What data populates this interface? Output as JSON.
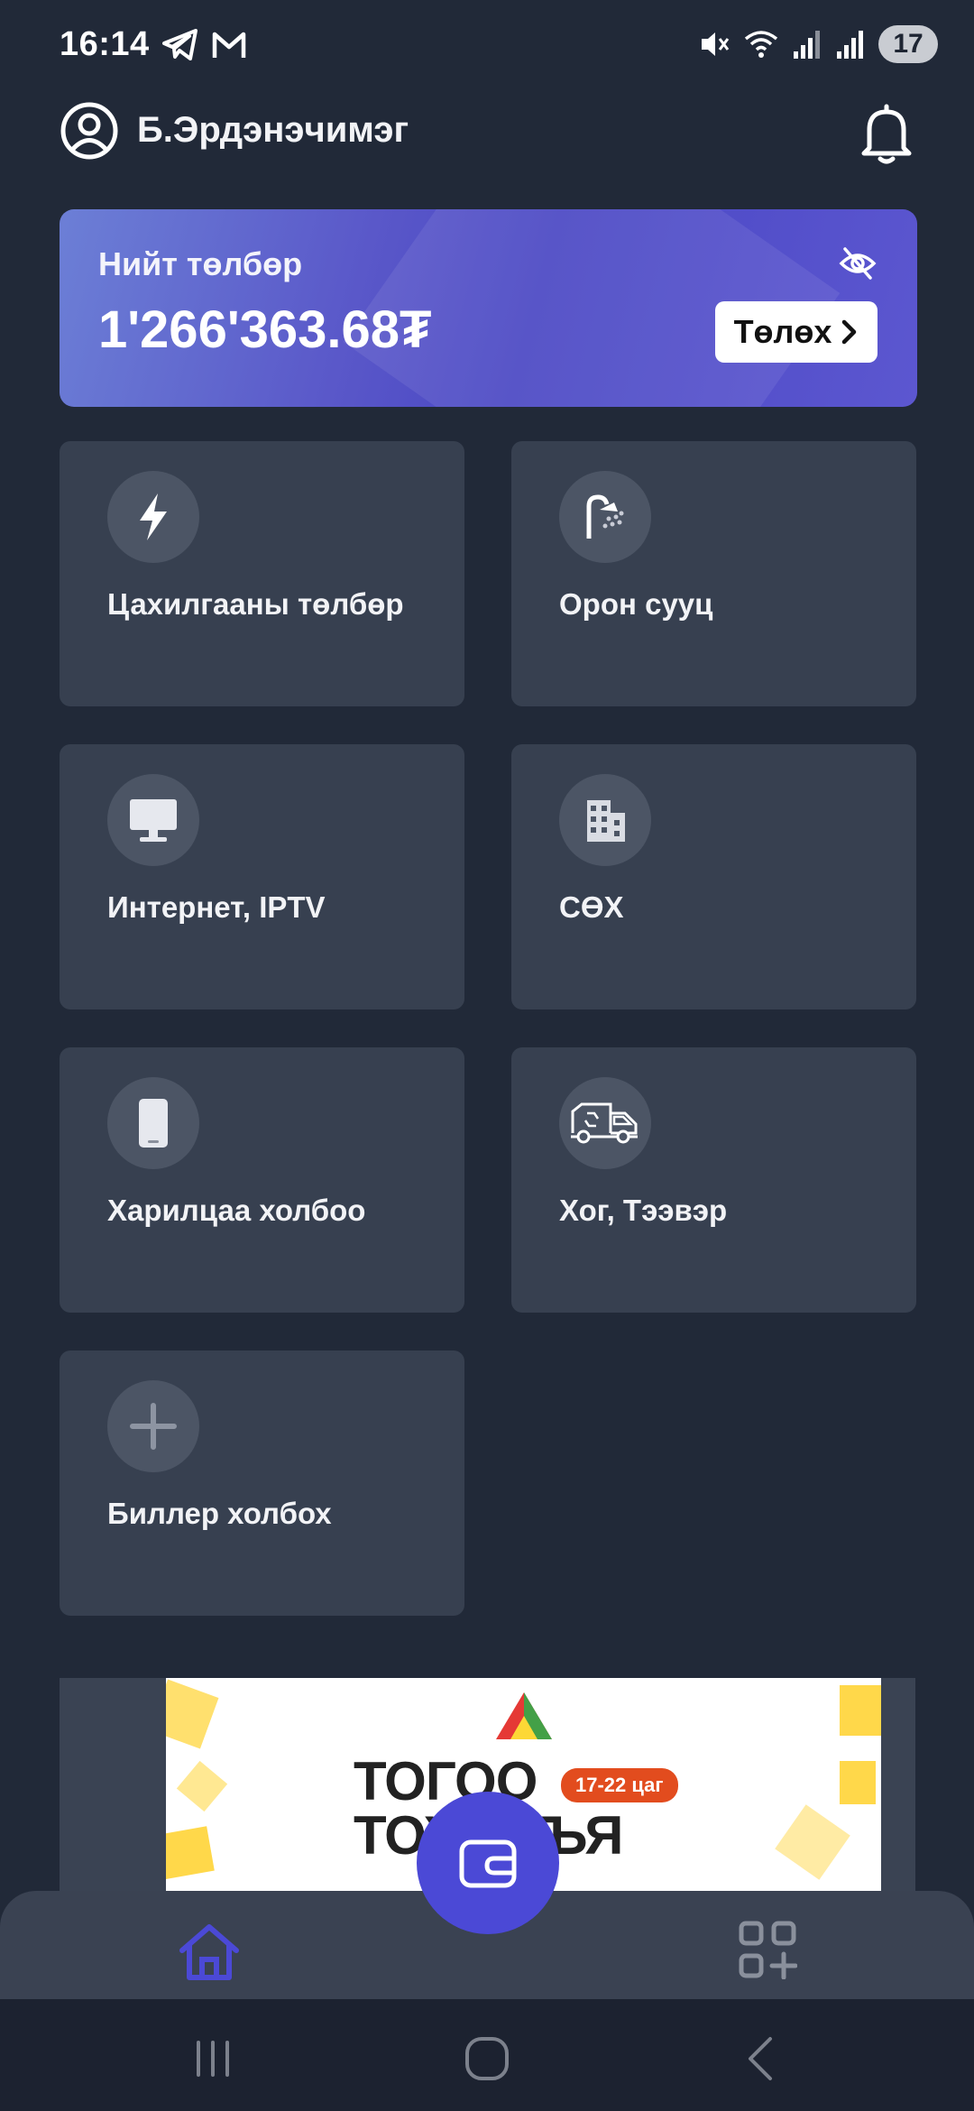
{
  "status_bar": {
    "time": "16:14",
    "battery": "17",
    "left_icons": [
      "telegram-icon",
      "gmail-icon"
    ],
    "right_icons": [
      "mute-icon",
      "wifi-icon",
      "signal-icon",
      "signal-icon"
    ]
  },
  "header": {
    "user_name": "Б.Эрдэнэчимэг"
  },
  "total_card": {
    "label": "Нийт төлбөр",
    "amount": "1'266'363.68₮",
    "pay_button": "Төлөх",
    "gradient_colors": [
      "#6c7fd6",
      "#4a47c4"
    ]
  },
  "tiles": [
    {
      "label": "Цахилгааны төлбөр",
      "icon": "lightning-icon"
    },
    {
      "label": "Орон сууц",
      "icon": "shower-icon"
    },
    {
      "label": "Интернет, IPTV",
      "icon": "monitor-icon"
    },
    {
      "label": "СӨХ",
      "icon": "building-icon"
    },
    {
      "label": "Харилцаа холбоо",
      "icon": "phone-icon"
    },
    {
      "label": "Хог, Тээвэр",
      "icon": "truck-icon"
    },
    {
      "label": "Биллер холбох",
      "icon": "plus-icon"
    }
  ],
  "banner": {
    "line1": "ТОГОО",
    "line2": "ТОХ УЛЪЯ",
    "badge": "17-22 цаг"
  },
  "bottom_nav": {
    "items": [
      "home-icon",
      "wallet-icon",
      "apps-add-icon"
    ],
    "active_color": "#4b49d6"
  },
  "colors": {
    "background": "#212938",
    "tile": "#374050",
    "accent": "#4b49d6"
  }
}
